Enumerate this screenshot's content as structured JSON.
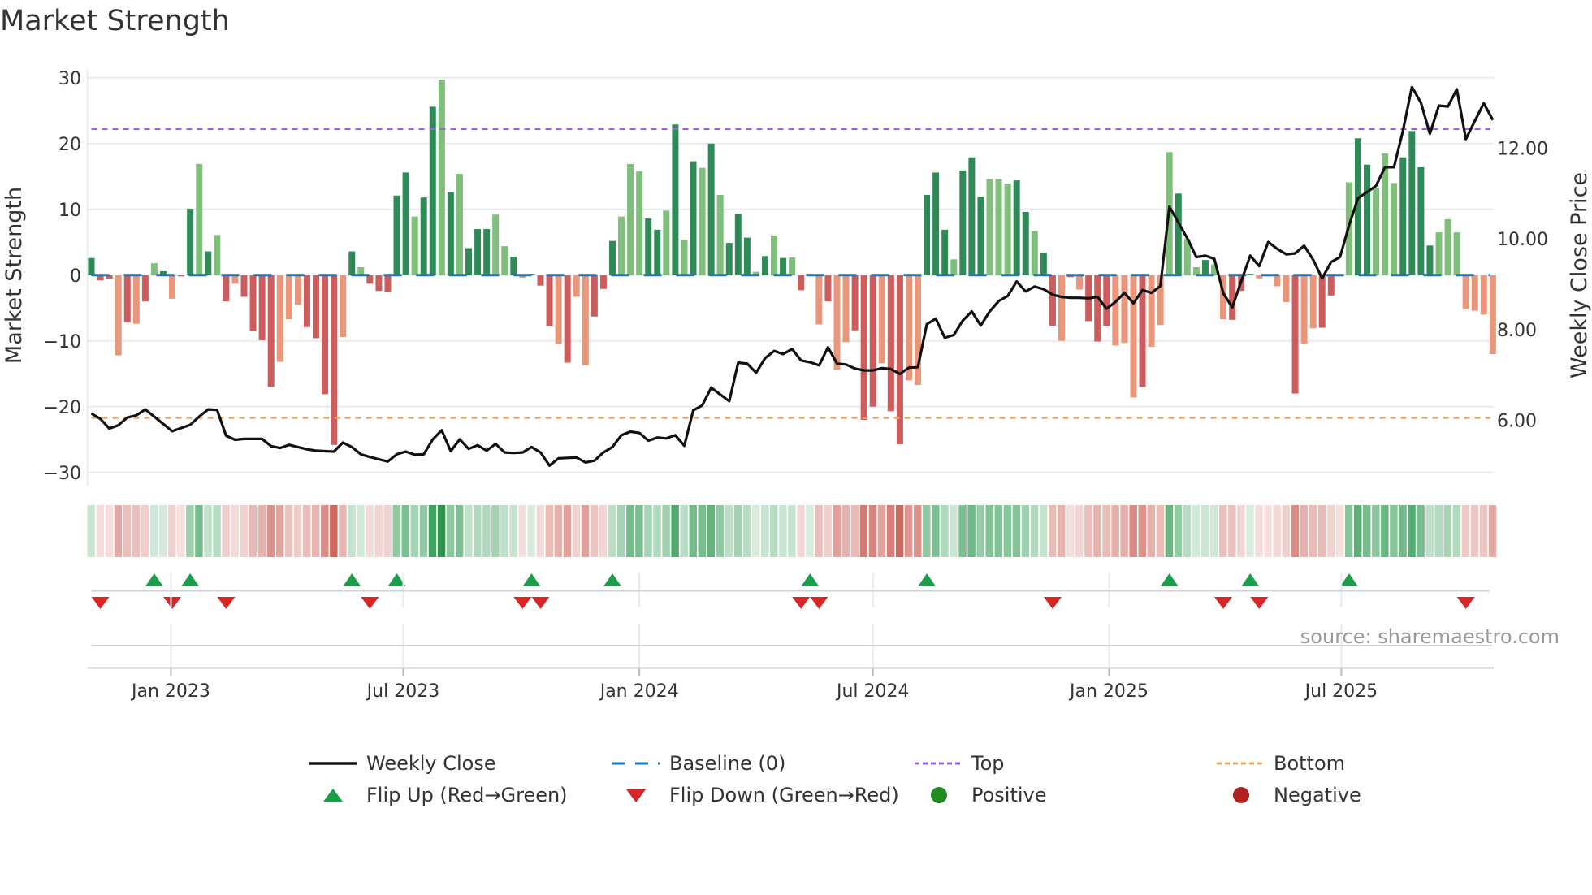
{
  "title": "Market Strength",
  "source": "source: sharemaestro.com",
  "legend": {
    "weekly_close": "Weekly Close",
    "baseline": "Baseline (0)",
    "top": "Top",
    "bottom": "Bottom",
    "flip_up": "Flip Up (Red→Green)",
    "flip_down": "Flip Down (Green→Red)",
    "positive": "Positive",
    "negative": "Negative"
  },
  "colors": {
    "bar_pos_dark": "#2e8b57",
    "bar_pos_light": "#7fbf7b",
    "bar_neg_dark": "#cd5c5c",
    "bar_neg_light": "#e9967a",
    "baseline": "#1f77b4",
    "top": "#9b5fe0",
    "bottom": "#f0a35e",
    "line": "#111111",
    "flip_up": "#1a9e4a",
    "flip_down": "#d62728",
    "positive": "#228b22",
    "negative": "#b22222"
  },
  "chart_data": {
    "type": "bar+line",
    "title": "Market Strength",
    "ylabel": "Market Strength",
    "y2label": "Weekly Close Price",
    "ylim": [
      -31.5,
      31.5
    ],
    "y2lim": [
      4.84,
      13.54
    ],
    "yticks": [
      "30",
      "20",
      "10",
      "0",
      "−10",
      "−20",
      "−30"
    ],
    "ytick_values": [
      30,
      20,
      10,
      0,
      -10,
      -20,
      -30
    ],
    "y2ticks": [
      "12.00",
      "10.00",
      "8.00",
      "6.00"
    ],
    "y2tick_values": [
      12,
      10,
      8,
      6
    ],
    "xticks": [
      "Jan 2023",
      "Jul 2023",
      "Jan 2024",
      "Jul 2024",
      "Jan 2025",
      "Jul 2025"
    ],
    "xtick_dates": [
      "2023-01-01",
      "2023-07-01",
      "2024-01-01",
      "2024-07-01",
      "2025-01-01",
      "2025-07-01"
    ],
    "start_date": "2022-10-31",
    "interval": "weekly",
    "top_level": 22.2,
    "bottom_level": -21.7,
    "baseline": 0,
    "strength": [
      2.6,
      -0.8,
      -0.6,
      -12.2,
      -7.2,
      -7.4,
      -4.0,
      1.8,
      0.6,
      -3.6,
      -0.2,
      10.1,
      16.9,
      3.6,
      6.1,
      -4.0,
      -1.3,
      -3.3,
      -8.5,
      -9.9,
      -17.0,
      -13.2,
      -6.7,
      -4.5,
      -7.9,
      -9.6,
      -18.1,
      -25.8,
      -9.4,
      3.6,
      1.2,
      -1.3,
      -2.4,
      -2.6,
      12.1,
      15.6,
      8.9,
      11.8,
      25.6,
      29.7,
      12.6,
      15.4,
      4.1,
      7.0,
      7.0,
      9.2,
      4.4,
      2.8,
      -0.4,
      0.2,
      -1.6,
      -7.8,
      -10.5,
      -13.3,
      -3.3,
      -13.7,
      -6.3,
      -2.1,
      5.2,
      8.9,
      16.9,
      15.8,
      8.6,
      6.9,
      9.8,
      22.9,
      5.4,
      17.3,
      16.3,
      20.0,
      12.2,
      4.9,
      9.3,
      5.7,
      0.5,
      2.9,
      6.0,
      2.6,
      2.7,
      -2.3,
      0.2,
      -7.5,
      -4.0,
      -14.4,
      -10.2,
      -8.4,
      -22.0,
      -20.0,
      -13.4,
      -20.7,
      -25.7,
      -16.0,
      -16.7,
      12.2,
      15.6,
      6.9,
      2.4,
      15.9,
      17.9,
      11.9,
      14.6,
      14.6,
      13.9,
      14.4,
      9.6,
      6.7,
      3.4,
      -7.7,
      -10.0,
      -0.3,
      -2.2,
      -7.0,
      -10.1,
      -7.7,
      -10.7,
      -10.3,
      -18.6,
      -17.0,
      -10.9,
      -7.6,
      18.7,
      12.4,
      5.5,
      1.2,
      2.3,
      1.6,
      -6.7,
      -6.8,
      -2.4,
      0.2,
      -0.5,
      -0.2,
      -1.7,
      -4.1,
      -18.0,
      -10.4,
      -8.1,
      -8.0,
      -3.1,
      -0.2,
      14.1,
      20.8,
      16.8,
      13.2,
      18.5,
      14.0,
      17.9,
      21.9,
      16.4,
      4.5,
      6.5,
      8.5,
      6.5,
      -5.2,
      -5.4,
      -6.0,
      -12.0
    ],
    "shade": "dddldldldlddldldlddddlllddddldldddddlddldldddlldldddldlldddlllddldldldldddldldldlldlldddlddlldddldddlllddlddldldddllldllldlldlldddlllldllddllddllldddd",
    "weekly_close": [
      6.15,
      6.03,
      5.82,
      5.89,
      6.06,
      6.11,
      6.24,
      6.08,
      5.92,
      5.76,
      5.83,
      5.9,
      6.08,
      6.24,
      6.23,
      5.66,
      5.57,
      5.59,
      5.59,
      5.59,
      5.43,
      5.39,
      5.46,
      5.41,
      5.36,
      5.33,
      5.32,
      5.31,
      5.51,
      5.41,
      5.25,
      5.19,
      5.14,
      5.09,
      5.25,
      5.31,
      5.24,
      5.25,
      5.58,
      5.78,
      5.32,
      5.58,
      5.37,
      5.45,
      5.33,
      5.48,
      5.29,
      5.28,
      5.29,
      5.41,
      5.29,
      5.0,
      5.16,
      5.17,
      5.18,
      5.07,
      5.11,
      5.29,
      5.41,
      5.67,
      5.75,
      5.72,
      5.55,
      5.62,
      5.6,
      5.67,
      5.44,
      6.22,
      6.33,
      6.72,
      6.57,
      6.42,
      7.27,
      7.25,
      7.05,
      7.37,
      7.53,
      7.46,
      7.57,
      7.32,
      7.28,
      7.21,
      7.61,
      7.25,
      7.23,
      7.14,
      7.1,
      7.1,
      7.15,
      7.13,
      7.02,
      7.16,
      7.17,
      8.12,
      8.24,
      7.82,
      7.88,
      8.2,
      8.4,
      8.09,
      8.4,
      8.63,
      8.74,
      9.06,
      8.84,
      8.95,
      8.89,
      8.77,
      8.72,
      8.7,
      8.7,
      8.69,
      8.72,
      8.46,
      8.61,
      8.81,
      8.58,
      8.87,
      8.81,
      8.96,
      10.71,
      10.36,
      10.01,
      9.6,
      9.63,
      9.56,
      8.8,
      8.49,
      9.07,
      9.63,
      9.4,
      9.93,
      9.78,
      9.66,
      9.68,
      9.85,
      9.54,
      9.13,
      9.49,
      9.6,
      10.3,
      10.9,
      11.03,
      11.17,
      11.58,
      11.58,
      12.39,
      13.35,
      13.0,
      12.32,
      12.94,
      12.92,
      13.3,
      12.2,
      12.6,
      12.99,
      12.62
    ],
    "flip_up_weeks": [
      7,
      11,
      29,
      34,
      49,
      58,
      80,
      93,
      120,
      129,
      140
    ],
    "flip_down_weeks": [
      1,
      9,
      15,
      31,
      48,
      50,
      79,
      81,
      107,
      126,
      130,
      153
    ]
  }
}
